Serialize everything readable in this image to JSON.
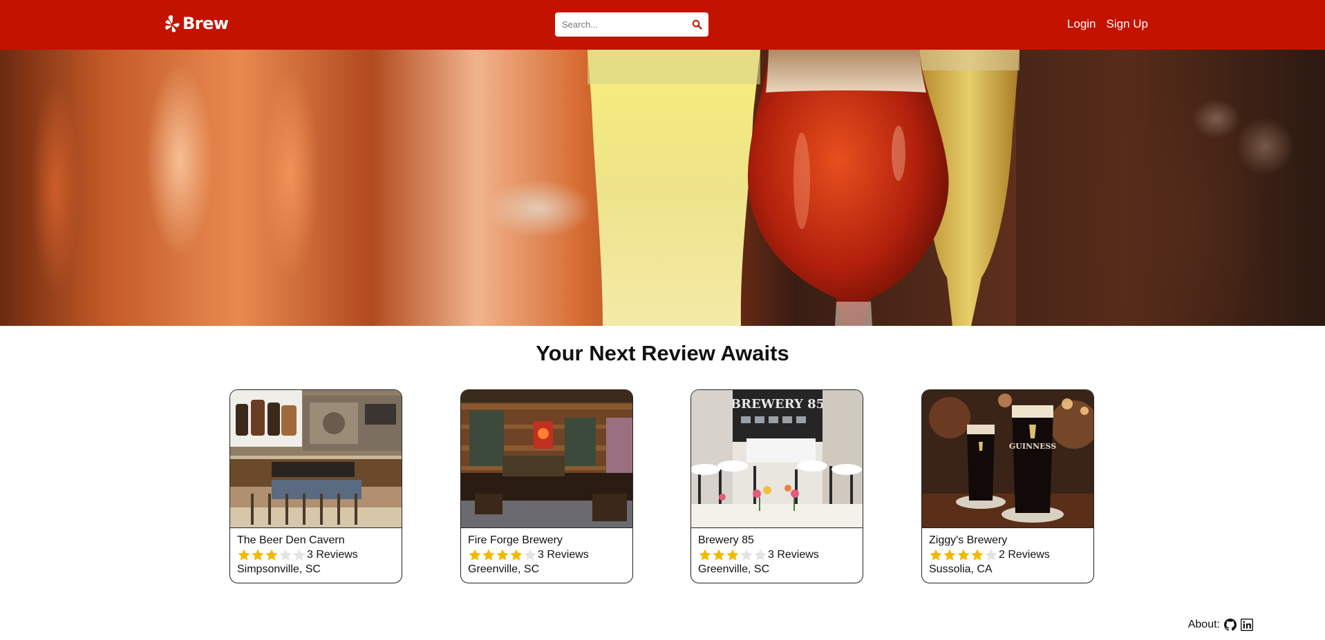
{
  "navbar": {
    "logo_text": "Brew",
    "logo_icon": "yelp-burst-icon",
    "search_placeholder": "Search...",
    "search_icon": "search-icon",
    "login_label": "Login",
    "signup_label": "Sign Up",
    "bg_color": "#c41200"
  },
  "hero": {
    "image": "beer-glasses-hero"
  },
  "section": {
    "title": "Your Next Review Awaits"
  },
  "breweries": [
    {
      "name": "The Beer Den Cavern",
      "rating": 3,
      "reviews": "3 Reviews",
      "location": "Simpsonville, SC"
    },
    {
      "name": "Fire Forge Brewery",
      "rating": 4,
      "reviews": "3 Reviews",
      "location": "Greenville, SC"
    },
    {
      "name": "Brewery 85",
      "rating": 3,
      "reviews": "3 Reviews",
      "location": "Greenville, SC",
      "sign_text": "BREWERY 85"
    },
    {
      "name": "Ziggy's Brewery",
      "rating": 4,
      "reviews": "2 Reviews",
      "location": "Sussolia, CA",
      "glass_text": "GUINNESS"
    }
  ],
  "star_colors": {
    "filled": "#f5b800",
    "empty": "#e3e3e3"
  },
  "footer": {
    "about_label": "About:",
    "icons": [
      "github-icon",
      "linkedin-icon"
    ]
  }
}
